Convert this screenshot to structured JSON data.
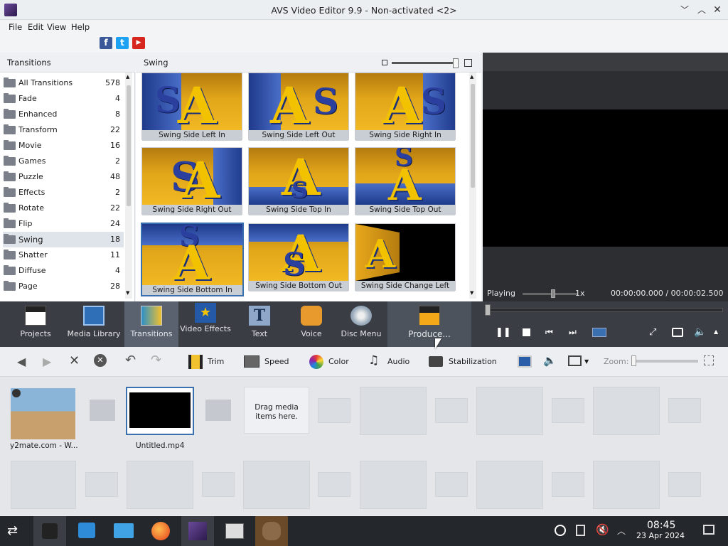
{
  "window": {
    "title": "AVS Video Editor 9.9 - Non-activated <2>"
  },
  "menu": {
    "items": [
      "File",
      "Edit",
      "View",
      "Help"
    ]
  },
  "transitions_panel": {
    "header": "Transitions",
    "categories": [
      {
        "name": "All Transitions",
        "count": "578"
      },
      {
        "name": "Fade",
        "count": "4"
      },
      {
        "name": "Enhanced",
        "count": "8"
      },
      {
        "name": "Transform",
        "count": "22"
      },
      {
        "name": "Movie",
        "count": "16"
      },
      {
        "name": "Games",
        "count": "2"
      },
      {
        "name": "Puzzle",
        "count": "48"
      },
      {
        "name": "Effects",
        "count": "2"
      },
      {
        "name": "Rotate",
        "count": "22"
      },
      {
        "name": "Flip",
        "count": "24"
      },
      {
        "name": "Swing",
        "count": "18"
      },
      {
        "name": "Shatter",
        "count": "11"
      },
      {
        "name": "Diffuse",
        "count": "4"
      },
      {
        "name": "Page",
        "count": "28"
      }
    ],
    "selected": "Swing"
  },
  "grid": {
    "header": "Swing",
    "items": [
      "Swing Side Left In",
      "Swing Side Left Out",
      "Swing Side Right In",
      "Swing Side Right Out",
      "Swing Side Top In",
      "Swing Side Top Out",
      "Swing Side Bottom In",
      "Swing Side Bottom Out",
      "Swing Side Change Left"
    ],
    "selected": "Swing Side Bottom In"
  },
  "preview": {
    "status": "Playing",
    "speed": "1x",
    "time": "00:00:00.000 / 00:00:02.500"
  },
  "toolbar": {
    "buttons": [
      "Projects",
      "Media Library",
      "Transitions",
      "Video Effects",
      "Text",
      "Voice",
      "Disc Menu",
      "Produce..."
    ],
    "selected": "Transitions"
  },
  "editbar": {
    "trim": "Trim",
    "speed": "Speed",
    "color": "Color",
    "audio": "Audio",
    "stabilization": "Stabilization",
    "zoom": "Zoom:"
  },
  "timeline": {
    "clip1": "y2mate.com - W...",
    "clip2": "Untitled.mp4",
    "drop_hint": "Drag media items here."
  },
  "taskbar": {
    "time": "08:45",
    "date": "23 Apr 2024"
  },
  "colors": {
    "accent": "#3a6fb0",
    "toolbar": "#3a3d43",
    "preview_bg": "#2d2e31"
  }
}
